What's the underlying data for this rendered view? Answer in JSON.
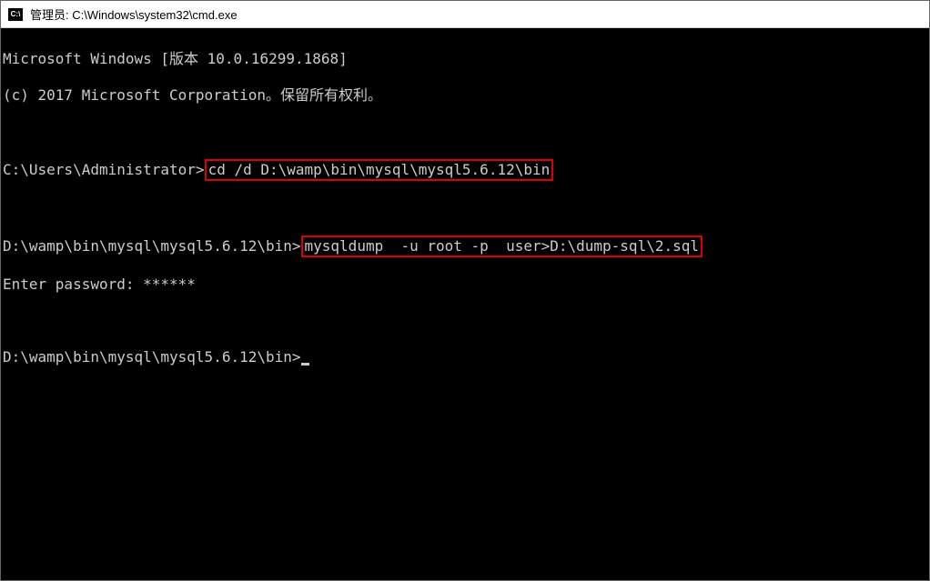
{
  "title_bar": {
    "icon_label": "C:\\",
    "title": "管理员: C:\\Windows\\system32\\cmd.exe"
  },
  "terminal": {
    "line1": "Microsoft Windows [版本 10.0.16299.1868]",
    "line2": "(c) 2017 Microsoft Corporation。保留所有权利。",
    "prompt1": "C:\\Users\\Administrator>",
    "cmd1": "cd /d D:\\wamp\\bin\\mysql\\mysql5.6.12\\bin",
    "prompt2": "D:\\wamp\\bin\\mysql\\mysql5.6.12\\bin>",
    "cmd2": "mysqldump  -u root -p  user>D:\\dump-sql\\2.sql",
    "pwline_label": "Enter password: ",
    "pwline_mask": "******",
    "prompt3": "D:\\wamp\\bin\\mysql\\mysql5.6.12\\bin>"
  }
}
